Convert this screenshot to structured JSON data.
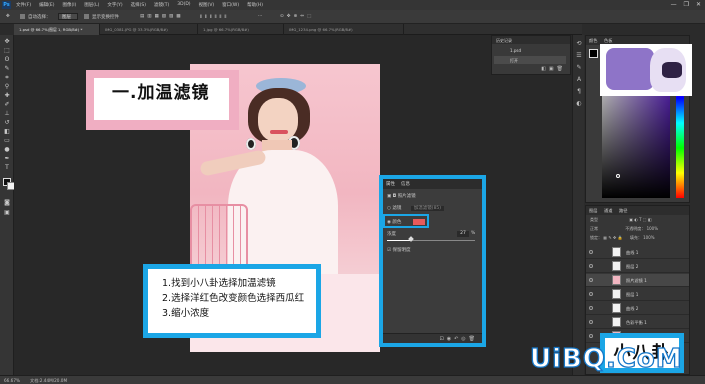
{
  "app": {
    "logo": "Ps",
    "menus": [
      "文件(F)",
      "编辑(E)",
      "图像(I)",
      "图层(L)",
      "文字(Y)",
      "选择(S)",
      "滤镜(T)",
      "3D(D)",
      "视图(V)",
      "窗口(W)",
      "帮助(H)"
    ],
    "window_controls": [
      "—",
      "❐",
      "✕"
    ]
  },
  "options": {
    "auto_select": "自动选择：",
    "layer_value": "图层",
    "show_transform": "显示变换控件"
  },
  "tabs": [
    {
      "label": "1.psd @ 66.7%(图层 1, RGB/8#) *",
      "active": true
    },
    {
      "label": "IMG_0381.JPG @ 33.3%(RGB/8#)",
      "active": false
    },
    {
      "label": "1.jpg @ 66.7%(RGB/8#)",
      "active": false
    },
    {
      "label": "IMG_1234.png @ 66.7%(RGB/8#)",
      "active": false
    }
  ],
  "canvas": {
    "title_callout": "一.加温滤镜",
    "steps": [
      "1.找到小八卦选择加温滤镜",
      "2.选择洋红色改变颜色选择西瓜红",
      "3.缩小浓度"
    ]
  },
  "properties_panel": {
    "tab_properties": "属性",
    "tab_info": "信息",
    "section": "照片滤镜",
    "filter_option": "滤镜",
    "filter_value": "加温滤镜(85)",
    "color_option": "颜色",
    "density_label": "浓度",
    "density_value": "27",
    "density_unit": "%",
    "preserve_luminosity": "保留明度",
    "filter_color": "#e85a5a"
  },
  "history_panel": {
    "title": "历史记录",
    "rows": [
      "1.psd",
      "打开"
    ]
  },
  "color_panel": {
    "tab_color": "颜色",
    "tab_swatches": "色板",
    "selected_color": "#6a2bd8"
  },
  "layers_panel": {
    "tabs": [
      "图层",
      "通道",
      "路径"
    ],
    "kind_label": "类型",
    "blend_mode": "正常",
    "opacity_label": "不透明度：",
    "opacity_value": "100%",
    "lock_label": "锁定：",
    "fill_label": "填充：",
    "fill_value": "100%",
    "layers": [
      "曲线 1",
      "图层 2",
      "照片滤镜 1",
      "图层 1",
      "曲线 2",
      "色彩平衡 1",
      "背景"
    ]
  },
  "corner_callout": "小八卦",
  "watermark": "UiBQ.CoM",
  "status": {
    "zoom": "66.67%",
    "doc": "文档:2.44M/20.0M"
  },
  "brand_colors": {
    "callout_blue": "#1ba6e6",
    "callout_pink": "#f0aec2"
  }
}
